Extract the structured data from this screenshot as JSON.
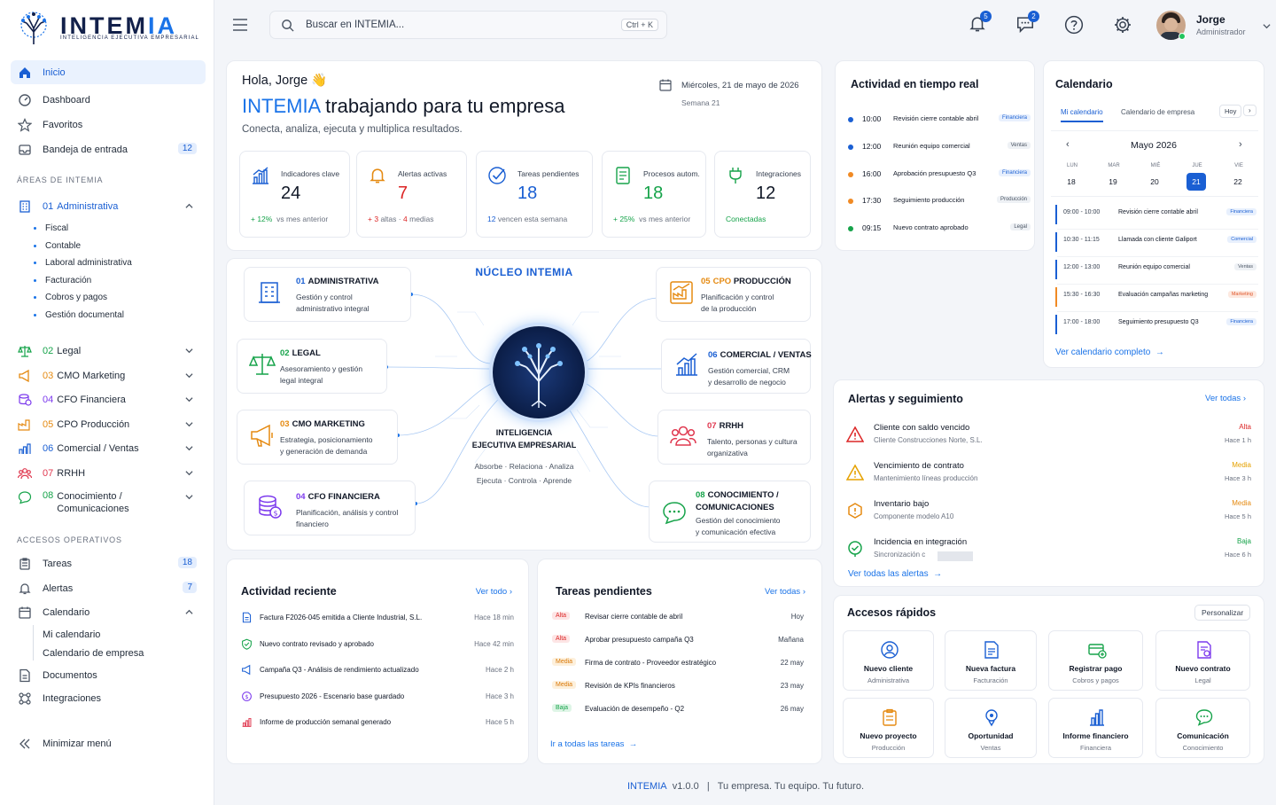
{
  "brand": {
    "name_a": "INTEM",
    "name_b": "IA",
    "tagline": "INTELIGENCIA EJECUTIVA EMPRESARIAL"
  },
  "nav": {
    "inicio": "Inicio",
    "dashboard": "Dashboard",
    "favoritos": "Favoritos",
    "bandeja": "Bandeja de entrada",
    "bandeja_count": "12"
  },
  "areas_title": "ÁREAS DE INTEMIA",
  "areas": [
    {
      "num": "01",
      "name": "Administrativa"
    },
    {
      "num": "02",
      "name": "Legal"
    },
    {
      "num": "03",
      "name": "CMO Marketing"
    },
    {
      "num": "04",
      "name": "CFO Financiera"
    },
    {
      "num": "05",
      "name": "CPO Producción"
    },
    {
      "num": "06",
      "name": "Comercial / Ventas"
    },
    {
      "num": "07",
      "name": "RRHH"
    },
    {
      "num": "08",
      "name": "Conocimiento /",
      "name2": "Comunicaciones"
    }
  ],
  "admin_sub": [
    "Fiscal",
    "Contable",
    "Laboral administrativa",
    "Facturación",
    "Cobros y pagos",
    "Gestión documental"
  ],
  "ops_title": "ACCESOS OPERATIVOS",
  "ops": {
    "tareas": "Tareas",
    "tareas_count": "18",
    "alertas": "Alertas",
    "alertas_count": "7",
    "calendario": "Calendario",
    "mi_cal": "Mi calendario",
    "cal_emp": "Calendario de empresa",
    "documentos": "Documentos",
    "integraciones": "Integraciones",
    "minimizar": "Minimizar menú"
  },
  "search": {
    "placeholder": "Buscar en INTEMIA...",
    "shortcut": "Ctrl + K"
  },
  "top": {
    "notif_count": "5",
    "msg_count": "2",
    "user_name": "Jorge",
    "user_role": "Administrador"
  },
  "hero": {
    "greeting": "Hola, Jorge",
    "wave": "👋",
    "title_brand": "INTEMIA",
    "title_rest": "trabajando para tu empresa",
    "subtitle": "Conecta, analiza, ejecuta y multiplica resultados.",
    "date": "Miércoles, 21 de mayo de 2026",
    "week": "Semana 21"
  },
  "kpis": [
    {
      "label": "Indicadores clave",
      "value": "24",
      "s1": "+ 12%",
      "s2": "vs mes anterior",
      "color": "#1a5fd3",
      "c1": "#16a34a"
    },
    {
      "label": "Alertas activas",
      "value": "7",
      "s1": "+ 3",
      "s2": "altas",
      "s3": "·",
      "s4": "4",
      "s5": "medias",
      "color": "#dc2626",
      "c1": "#dc2626"
    },
    {
      "label": "Tareas pendientes",
      "value": "18",
      "s1": "12",
      "s2": "vencen esta semana",
      "color": "#1a5fd3",
      "c1": "#1a5fd3"
    },
    {
      "label": "Procesos autom.",
      "value": "18",
      "s1": "+ 25%",
      "s2": "vs mes anterior",
      "color": "#16a34a",
      "c1": "#16a34a"
    },
    {
      "label": "Integraciones",
      "value": "12",
      "s1": "Conectadas",
      "s2": "",
      "color": "#16a34a",
      "c1": "#16a34a"
    }
  ],
  "nucleo": {
    "title": "NÚCLEO INTEMIA",
    "brain1": "INTELIGENCIA",
    "brain2": "EJECUTIVA EMPRESARIAL",
    "line1": "Absorbe · Relaciona · Analiza",
    "line2": "Ejecuta · Controla · Aprende"
  },
  "nodes": [
    {
      "num": "01",
      "name": "ADMINISTRATIVA",
      "d1": "Gestión y control",
      "d2": "administrativo integral"
    },
    {
      "num": "02",
      "name": "LEGAL",
      "d1": "Asesoramiento y gestión",
      "d2": "legal integral"
    },
    {
      "num": "03",
      "name": "CMO MARKETING",
      "d1": "Estrategia, posicionamiento",
      "d2": "y generación de demanda"
    },
    {
      "num": "04",
      "name": "CFO FINANCIERA",
      "d1": "Planificación, análisis y control",
      "d2": "financiero"
    },
    {
      "num": "05",
      "name": "CPO",
      "name2": "PRODUCCIÓN",
      "d1": "Planificación y control",
      "d2": "de la producción"
    },
    {
      "num": "06",
      "name": "COMERCIAL / VENTAS",
      "d1": "Gestión comercial, CRM",
      "d2": "y desarrollo de negocio"
    },
    {
      "num": "07",
      "name": "RRHH",
      "d1": "Talento, personas y cultura",
      "d2": "organizativa"
    },
    {
      "num": "08",
      "name": "CONOCIMIENTO /",
      "name2": "COMUNICACIONES",
      "d1": "Gestión del conocimiento",
      "d2": "y comunicación efectiva"
    }
  ],
  "realtime": {
    "title": "Actividad en tiempo real",
    "items": [
      {
        "time": "10:00",
        "text": "Revisión cierre contable abril",
        "tag": "Financiera",
        "dot": "#1a5fd3"
      },
      {
        "time": "12:00",
        "text": "Reunión equipo comercial",
        "tag": "Ventas",
        "dot": "#1a5fd3"
      },
      {
        "time": "16:00",
        "text": "Aprobación presupuesto Q3",
        "tag": "Financiera",
        "dot": "#f08a24"
      },
      {
        "time": "17:30",
        "text": "Seguimiento producción",
        "tag": "Producción",
        "dot": "#f08a24"
      },
      {
        "time": "09:15",
        "text": "Nuevo contrato aprobado",
        "tag": "Legal",
        "dot": "#16a34a"
      }
    ]
  },
  "calendar": {
    "title": "Calendario",
    "tab1": "Mi calendario",
    "tab2": "Calendario de empresa",
    "today": "Hoy",
    "month": "Mayo 2026",
    "days": [
      {
        "d": "LUN",
        "n": "18"
      },
      {
        "d": "MAR",
        "n": "19"
      },
      {
        "d": "MIÉ",
        "n": "20"
      },
      {
        "d": "JUE",
        "n": "21"
      },
      {
        "d": "VIE",
        "n": "22"
      }
    ],
    "events": [
      {
        "time": "09:00 - 10:00",
        "text": "Revisión cierre contable abril",
        "tag": "Financiera",
        "color": "#1a5fd3"
      },
      {
        "time": "10:30 - 11:15",
        "text": "Llamada con cliente Galiport",
        "tag": "Comercial",
        "color": "#1a5fd3"
      },
      {
        "time": "12:00 - 13:00",
        "text": "Reunión equipo comercial",
        "tag": "Ventas",
        "color": "#1a5fd3"
      },
      {
        "time": "15:30 - 16:30",
        "text": "Evaluación campañas marketing",
        "tag": "Marketing",
        "color": "#f08a24"
      },
      {
        "time": "17:00 - 18:00",
        "text": "Seguimiento presupuesto Q3",
        "tag": "Financiera",
        "color": "#1a5fd3"
      }
    ],
    "link": "Ver calendario completo"
  },
  "alerts": {
    "title": "Alertas y seguimiento",
    "see_all": "Ver todas",
    "items": [
      {
        "t": "Cliente con saldo vencido",
        "s": "Cliente Construcciones Norte, S.L.",
        "lvl": "Alta",
        "ago": "Hace 1 h",
        "color": "#dc2626"
      },
      {
        "t": "Vencimiento de contrato",
        "s": "Mantenimiento líneas producción",
        "lvl": "Media",
        "ago": "Hace 3 h",
        "color": "#e5a100"
      },
      {
        "t": "Inventario bajo",
        "s": "Componente modelo A10",
        "lvl": "Media",
        "ago": "Hace 5 h",
        "color": "#e58a11"
      },
      {
        "t": "Incidencia en integración",
        "s": "Sincronización c",
        "lvl": "Baja",
        "ago": "Hace 6 h",
        "color": "#16a34a"
      }
    ],
    "link": "Ver todas las alertas"
  },
  "recent": {
    "title": "Actividad reciente",
    "see_all": "Ver todo",
    "items": [
      {
        "t": "Factura F2026-045 emitida a Cliente Industrial, S.L.",
        "ago": "Hace 18 min"
      },
      {
        "t": "Nuevo contrato revisado y aprobado",
        "ago": "Hace 42 min"
      },
      {
        "t": "Campaña Q3 - Análisis de rendimiento actualizado",
        "ago": "Hace 2 h"
      },
      {
        "t": "Presupuesto 2026 - Escenario base guardado",
        "ago": "Hace 3 h"
      },
      {
        "t": "Informe de producción semanal generado",
        "ago": "Hace 5 h"
      }
    ]
  },
  "tasks": {
    "title": "Tareas pendientes",
    "see_all": "Ver todas",
    "items": [
      {
        "p": "Alta",
        "t": "Revisar cierre contable de abril",
        "d": "Hoy"
      },
      {
        "p": "Alta",
        "t": "Aprobar presupuesto campaña Q3",
        "d": "Mañana"
      },
      {
        "p": "Media",
        "t": "Firma de contrato - Proveedor estratégico",
        "d": "22 may"
      },
      {
        "p": "Media",
        "t": "Revisión de KPIs financieros",
        "d": "23 may"
      },
      {
        "p": "Baja",
        "t": "Evaluación de desempeño - Q2",
        "d": "26 may"
      }
    ],
    "link": "Ir a todas las tareas"
  },
  "quick": {
    "title": "Accesos rápidos",
    "customize": "Personalizar",
    "items": [
      {
        "a": "Nuevo cliente",
        "b": "Administrativa"
      },
      {
        "a": "Nueva factura",
        "b": "Facturación"
      },
      {
        "a": "Registrar pago",
        "b": "Cobros y pagos"
      },
      {
        "a": "Nuevo contrato",
        "b": "Legal"
      },
      {
        "a": "Nuevo proyecto",
        "b": "Producción"
      },
      {
        "a": "Oportunidad",
        "b": "Ventas"
      },
      {
        "a": "Informe financiero",
        "b": "Financiera"
      },
      {
        "a": "Comunicación",
        "b": "Conocimiento"
      }
    ]
  },
  "footer": {
    "brand": "INTEMIA",
    "version": "v1.0.0",
    "sep": "|",
    "tagline": "Tu empresa. Tu equipo. Tu futuro."
  }
}
